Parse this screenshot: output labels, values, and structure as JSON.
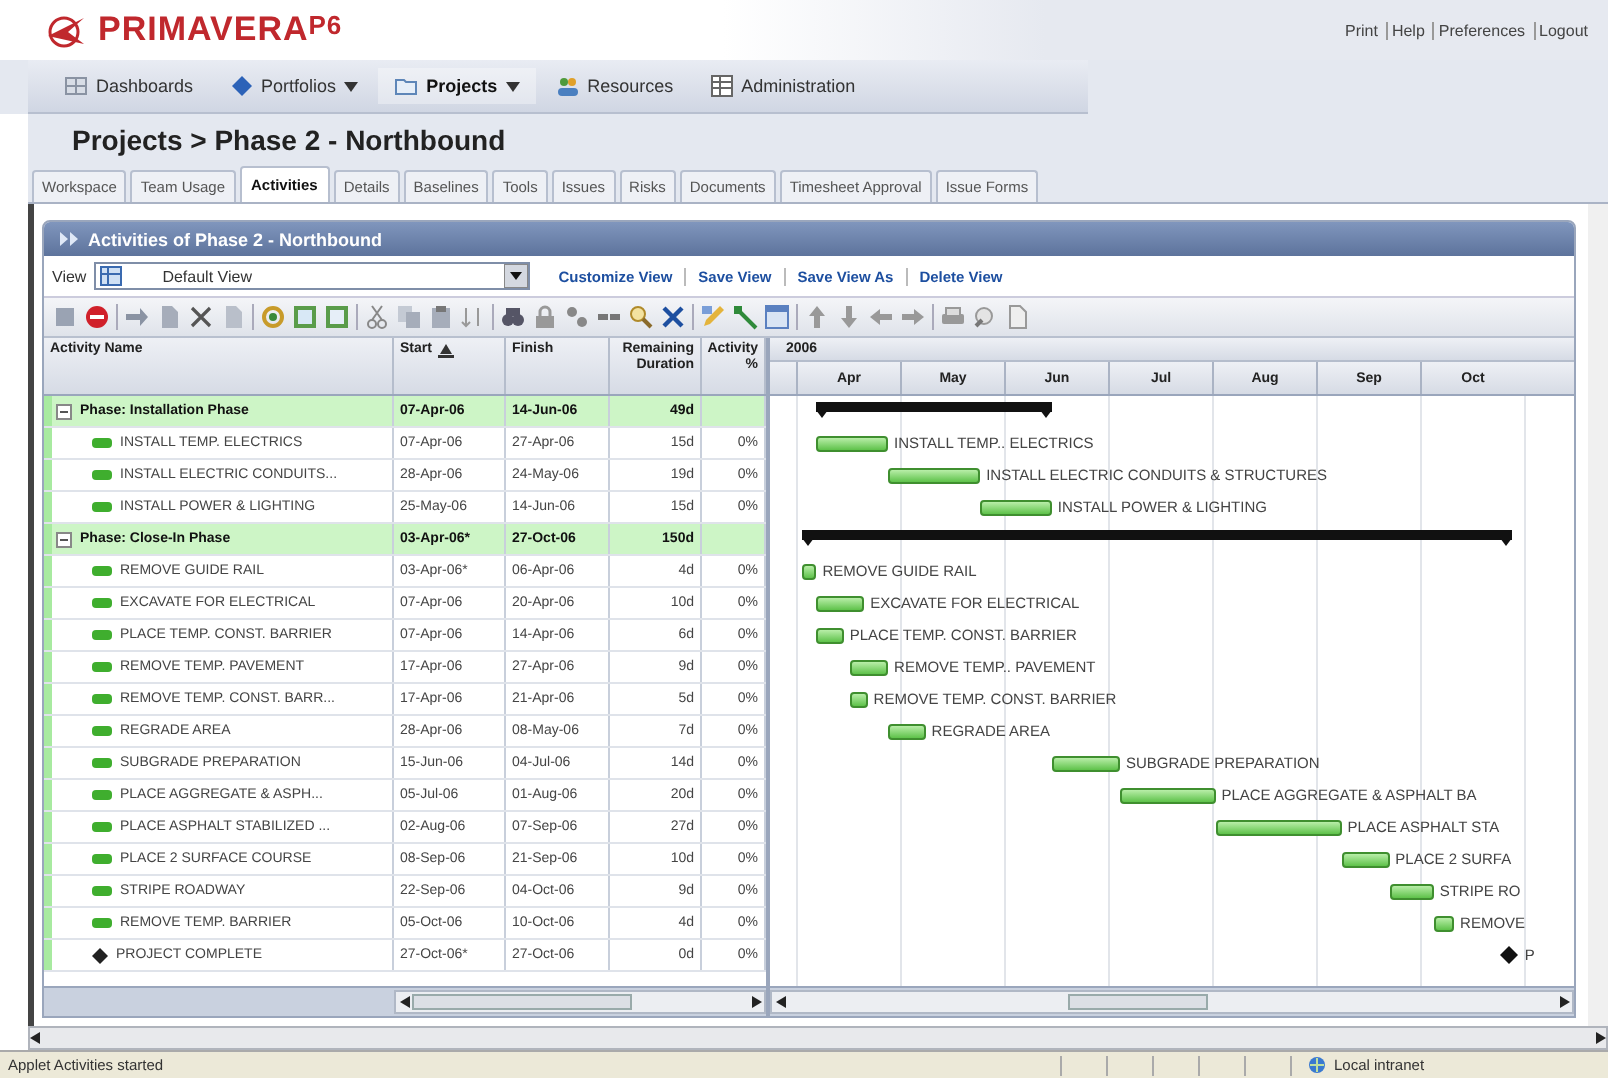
{
  "header": {
    "logo": "PRIMAVERA",
    "logo_suffix": "P6",
    "links": [
      "Print",
      "Help",
      "Preferences",
      "Logout"
    ]
  },
  "nav": [
    {
      "label": "Dashboards",
      "dropdown": false,
      "selected": false
    },
    {
      "label": "Portfolios",
      "dropdown": true,
      "selected": false
    },
    {
      "label": "Projects",
      "dropdown": true,
      "selected": true
    },
    {
      "label": "Resources",
      "dropdown": false,
      "selected": false
    },
    {
      "label": "Administration",
      "dropdown": false,
      "selected": false
    }
  ],
  "breadcrumb": "Projects > Phase 2 - Northbound",
  "tabs": [
    {
      "label": "Workspace",
      "selected": false
    },
    {
      "label": "Team Usage",
      "selected": false
    },
    {
      "label": "Activities",
      "selected": true
    },
    {
      "label": "Details",
      "selected": false
    },
    {
      "label": "Baselines",
      "selected": false
    },
    {
      "label": "Tools",
      "selected": false
    },
    {
      "label": "Issues",
      "selected": false
    },
    {
      "label": "Risks",
      "selected": false
    },
    {
      "label": "Documents",
      "selected": false
    },
    {
      "label": "Timesheet Approval",
      "selected": false
    },
    {
      "label": "Issue Forms",
      "selected": false
    }
  ],
  "panel": {
    "title": "Activities of Phase 2 - Northbound",
    "view_label": "View",
    "view_value": "Default View",
    "view_links": [
      "Customize View",
      "Save View",
      "Save View As",
      "Delete View"
    ],
    "columns": [
      "Activity Name",
      "Start",
      "Finish",
      "Remaining Duration",
      "Activity %"
    ],
    "gantt_year": "2006",
    "months": [
      "Apr",
      "May",
      "Jun",
      "Jul",
      "Aug",
      "Sep",
      "Oct"
    ],
    "rows": [
      {
        "kind": "summary",
        "name": "Phase: Installation Phase",
        "start": "07-Apr-06",
        "finish": "14-Jun-06",
        "remaining": "49d",
        "percent": "",
        "bar_label": ""
      },
      {
        "kind": "task",
        "name": "INSTALL TEMP. ELECTRICS",
        "start": "07-Apr-06",
        "finish": "27-Apr-06",
        "remaining": "15d",
        "percent": "0%",
        "bar_label": "INSTALL TEMP.. ELECTRICS"
      },
      {
        "kind": "task",
        "name": "INSTALL ELECTRIC CONDUITS...",
        "start": "28-Apr-06",
        "finish": "24-May-06",
        "remaining": "19d",
        "percent": "0%",
        "bar_label": "INSTALL ELECTRIC CONDUITS & STRUCTURES"
      },
      {
        "kind": "task",
        "name": "INSTALL POWER & LIGHTING",
        "start": "25-May-06",
        "finish": "14-Jun-06",
        "remaining": "15d",
        "percent": "0%",
        "bar_label": "INSTALL POWER & LIGHTING"
      },
      {
        "kind": "summary",
        "name": "Phase: Close-In Phase",
        "start": "03-Apr-06*",
        "finish": "27-Oct-06",
        "remaining": "150d",
        "percent": "",
        "bar_label": ""
      },
      {
        "kind": "task",
        "name": "REMOVE GUIDE RAIL",
        "start": "03-Apr-06*",
        "finish": "06-Apr-06",
        "remaining": "4d",
        "percent": "0%",
        "bar_label": "REMOVE GUIDE RAIL"
      },
      {
        "kind": "task",
        "name": "EXCAVATE FOR ELECTRICAL",
        "start": "07-Apr-06",
        "finish": "20-Apr-06",
        "remaining": "10d",
        "percent": "0%",
        "bar_label": "EXCAVATE FOR ELECTRICAL"
      },
      {
        "kind": "task",
        "name": "PLACE TEMP. CONST. BARRIER",
        "start": "07-Apr-06",
        "finish": "14-Apr-06",
        "remaining": "6d",
        "percent": "0%",
        "bar_label": "PLACE TEMP. CONST. BARRIER"
      },
      {
        "kind": "task",
        "name": "REMOVE TEMP. PAVEMENT",
        "start": "17-Apr-06",
        "finish": "27-Apr-06",
        "remaining": "9d",
        "percent": "0%",
        "bar_label": "REMOVE TEMP.. PAVEMENT"
      },
      {
        "kind": "task",
        "name": "REMOVE TEMP. CONST. BARR...",
        "start": "17-Apr-06",
        "finish": "21-Apr-06",
        "remaining": "5d",
        "percent": "0%",
        "bar_label": "REMOVE TEMP. CONST. BARRIER"
      },
      {
        "kind": "task",
        "name": "REGRADE AREA",
        "start": "28-Apr-06",
        "finish": "08-May-06",
        "remaining": "7d",
        "percent": "0%",
        "bar_label": "REGRADE AREA"
      },
      {
        "kind": "task",
        "name": "SUBGRADE PREPARATION",
        "start": "15-Jun-06",
        "finish": "04-Jul-06",
        "remaining": "14d",
        "percent": "0%",
        "bar_label": "SUBGRADE PREPARATION"
      },
      {
        "kind": "task",
        "name": "PLACE AGGREGATE & ASPH...",
        "start": "05-Jul-06",
        "finish": "01-Aug-06",
        "remaining": "20d",
        "percent": "0%",
        "bar_label": "PLACE AGGREGATE & ASPHALT BA"
      },
      {
        "kind": "task",
        "name": "PLACE ASPHALT STABILIZED ...",
        "start": "02-Aug-06",
        "finish": "07-Sep-06",
        "remaining": "27d",
        "percent": "0%",
        "bar_label": "PLACE ASPHALT STA"
      },
      {
        "kind": "task",
        "name": "PLACE 2 SURFACE COURSE",
        "start": "08-Sep-06",
        "finish": "21-Sep-06",
        "remaining": "10d",
        "percent": "0%",
        "bar_label": "PLACE 2 SURFA"
      },
      {
        "kind": "task",
        "name": "STRIPE ROADWAY",
        "start": "22-Sep-06",
        "finish": "04-Oct-06",
        "remaining": "9d",
        "percent": "0%",
        "bar_label": "STRIPE RO"
      },
      {
        "kind": "task",
        "name": "REMOVE TEMP. BARRIER",
        "start": "05-Oct-06",
        "finish": "10-Oct-06",
        "remaining": "4d",
        "percent": "0%",
        "bar_label": "REMOVE"
      },
      {
        "kind": "milestone",
        "name": "PROJECT COMPLETE",
        "start": "27-Oct-06*",
        "finish": "27-Oct-06",
        "remaining": "0d",
        "percent": "0%",
        "bar_label": "P"
      }
    ]
  },
  "status_bar": {
    "message": "Applet Activities started",
    "zone": "Local intranet"
  }
}
